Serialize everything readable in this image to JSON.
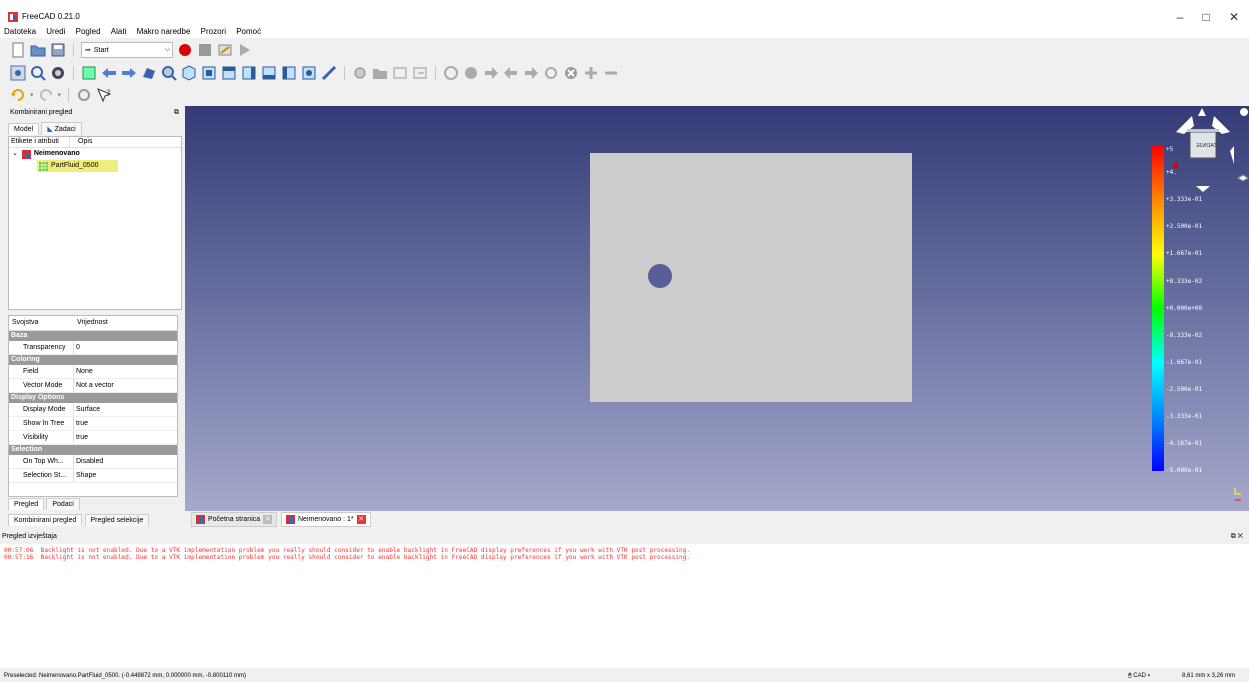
{
  "window": {
    "title": "FreeCAD 0.21.0",
    "minimize": "–",
    "restore": "□",
    "close": "✕"
  },
  "menu": [
    "Datoteka",
    "Uredi",
    "Pogled",
    "Alati",
    "Makro naredbe",
    "Prozori",
    "Pomoć"
  ],
  "toolbar": {
    "workbench": "Start"
  },
  "panel": {
    "title": "Kombinirani pregled",
    "tabs": [
      "Model",
      "Zadaci"
    ],
    "tree_columns": [
      "Etikete i atributi",
      "Opis"
    ],
    "document": "Neimenovano",
    "object": "PartFluid_0500",
    "prop_columns": [
      "Svojstva",
      "Vrijednost"
    ],
    "groups": [
      {
        "name": "Baza",
        "rows": [
          {
            "k": "Transparency",
            "v": "0"
          }
        ]
      },
      {
        "name": "Coloring",
        "rows": [
          {
            "k": "Field",
            "v": "None"
          },
          {
            "k": "Vector Mode",
            "v": "Not a vector"
          }
        ]
      },
      {
        "name": "Display Options",
        "rows": [
          {
            "k": "Display Mode",
            "v": "Surface"
          },
          {
            "k": "Show In Tree",
            "v": "true"
          },
          {
            "k": "Visibility",
            "v": "true"
          }
        ]
      },
      {
        "name": "Selection",
        "rows": [
          {
            "k": "On Top Wh...",
            "v": "Disabled"
          },
          {
            "k": "Selection St...",
            "v": "Shape"
          }
        ]
      }
    ],
    "bottom_tabs": [
      "Pregled",
      "Podaci"
    ],
    "dock_tabs": [
      "Kombinirani pregled",
      "Pregled selekcije"
    ]
  },
  "navcube": {
    "face": "ZADNJE"
  },
  "colorbar": [
    "+5",
    "+4.",
    "+3.333e-01",
    "+2.500e-01",
    "+1.667e-01",
    "+8.333e-02",
    "+0.000e+00",
    "-8.333e-02",
    "-1.667e-01",
    "-2.500e-01",
    "-3.333e-01",
    "-4.167e-01",
    "-5.000e-01"
  ],
  "doc_tabs": [
    "Početna stranica",
    "Neimenovano : 1*"
  ],
  "report": {
    "title": "Pregled izvještaja",
    "lines": [
      "00:57:06  Backlight is not enabled. Due to a VTK implementation problem you really should consider to enable backlight in FreeCAD display preferences if you work with VTK post processing.",
      "00:57:16  Backlight is not enabled. Due to a VTK implementation problem you really should consider to enable backlight in FreeCAD display preferences if you work with VTK post processing."
    ]
  },
  "status": {
    "text": "Preselected: Neimenovano.PartFluid_0500. (-0.449872 mm, 0.000000 mm, -0.800110 mm)",
    "nav_style": "CAD",
    "dimensions": "8,61 mm x 3,26 mm"
  }
}
